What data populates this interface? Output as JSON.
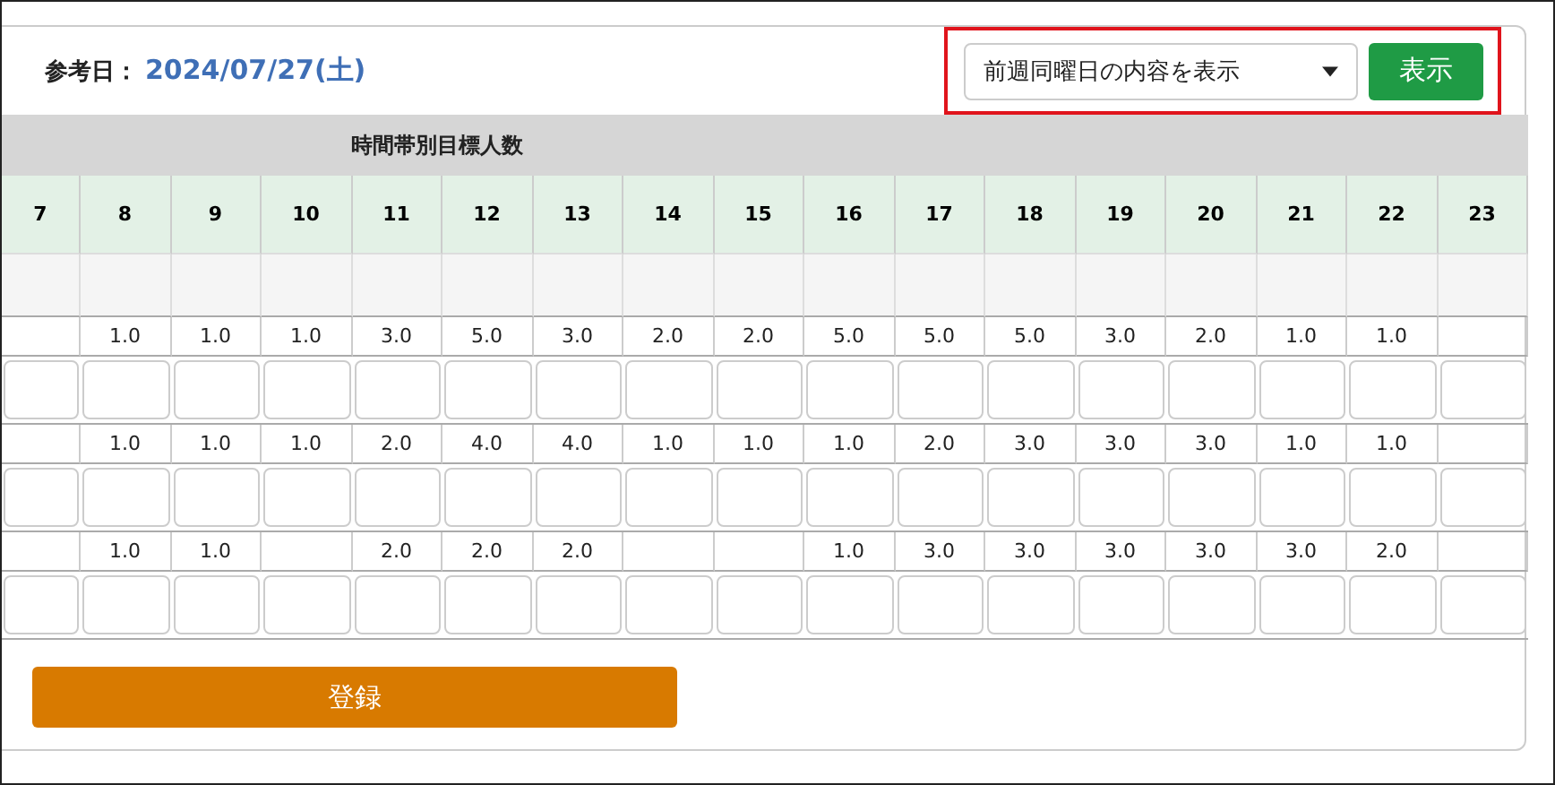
{
  "reference_date": {
    "label": "参考日：",
    "value": "2024/07/27(土)"
  },
  "display_select": {
    "value": "前週同曜日の内容を表示"
  },
  "show_button": {
    "label": "表示"
  },
  "highlight_frame": true,
  "table": {
    "title": "時間帯別目標人数",
    "hours": [
      "7",
      "8",
      "9",
      "10",
      "11",
      "12",
      "13",
      "14",
      "15",
      "16",
      "17",
      "18",
      "19",
      "20",
      "21",
      "22",
      "23"
    ],
    "groups": [
      {
        "cells": [
          {},
          {
            "text": "1.0"
          },
          {
            "text": "1.0"
          },
          {
            "text": "1.0"
          },
          {
            "text": "3.0"
          },
          {
            "text": "5.0"
          },
          {
            "text": "3.0"
          },
          {
            "text": "2.0"
          },
          {
            "text": "2.0"
          },
          {
            "text": "5.0"
          },
          {
            "text": "5.0"
          },
          {
            "text": "5.0"
          },
          {
            "text": "3.0"
          },
          {
            "text": "2.0"
          },
          {
            "text": "1.0"
          },
          {
            "text": "1.0"
          },
          {}
        ]
      },
      {
        "cells": [
          {},
          {
            "text": "1.0"
          },
          {
            "text": "1.0"
          },
          {
            "text": "1.0"
          },
          {
            "text": "2.0"
          },
          {
            "text": "4.0"
          },
          {
            "text": "4.0"
          },
          {
            "text": "1.0"
          },
          {
            "text": "1.0"
          },
          {
            "text": "1.0"
          },
          {
            "text": "2.0"
          },
          {
            "text": "3.0"
          },
          {
            "text": "3.0"
          },
          {
            "text": "3.0"
          },
          {
            "text": "1.0"
          },
          {
            "text": "1.0"
          },
          {}
        ]
      },
      {
        "cells": [
          {},
          {
            "text": "1.0"
          },
          {
            "text": "1.0"
          },
          {},
          {
            "text": "2.0"
          },
          {
            "text": "2.0"
          },
          {
            "text": "2.0"
          },
          {},
          {},
          {
            "text": "1.0"
          },
          {
            "text": "3.0"
          },
          {
            "text": "3.0"
          },
          {
            "text": "3.0"
          },
          {
            "text": "3.0"
          },
          {
            "text": "3.0"
          },
          {
            "text": "2.0"
          },
          {}
        ]
      }
    ]
  },
  "register_button": {
    "label": "登録"
  }
}
